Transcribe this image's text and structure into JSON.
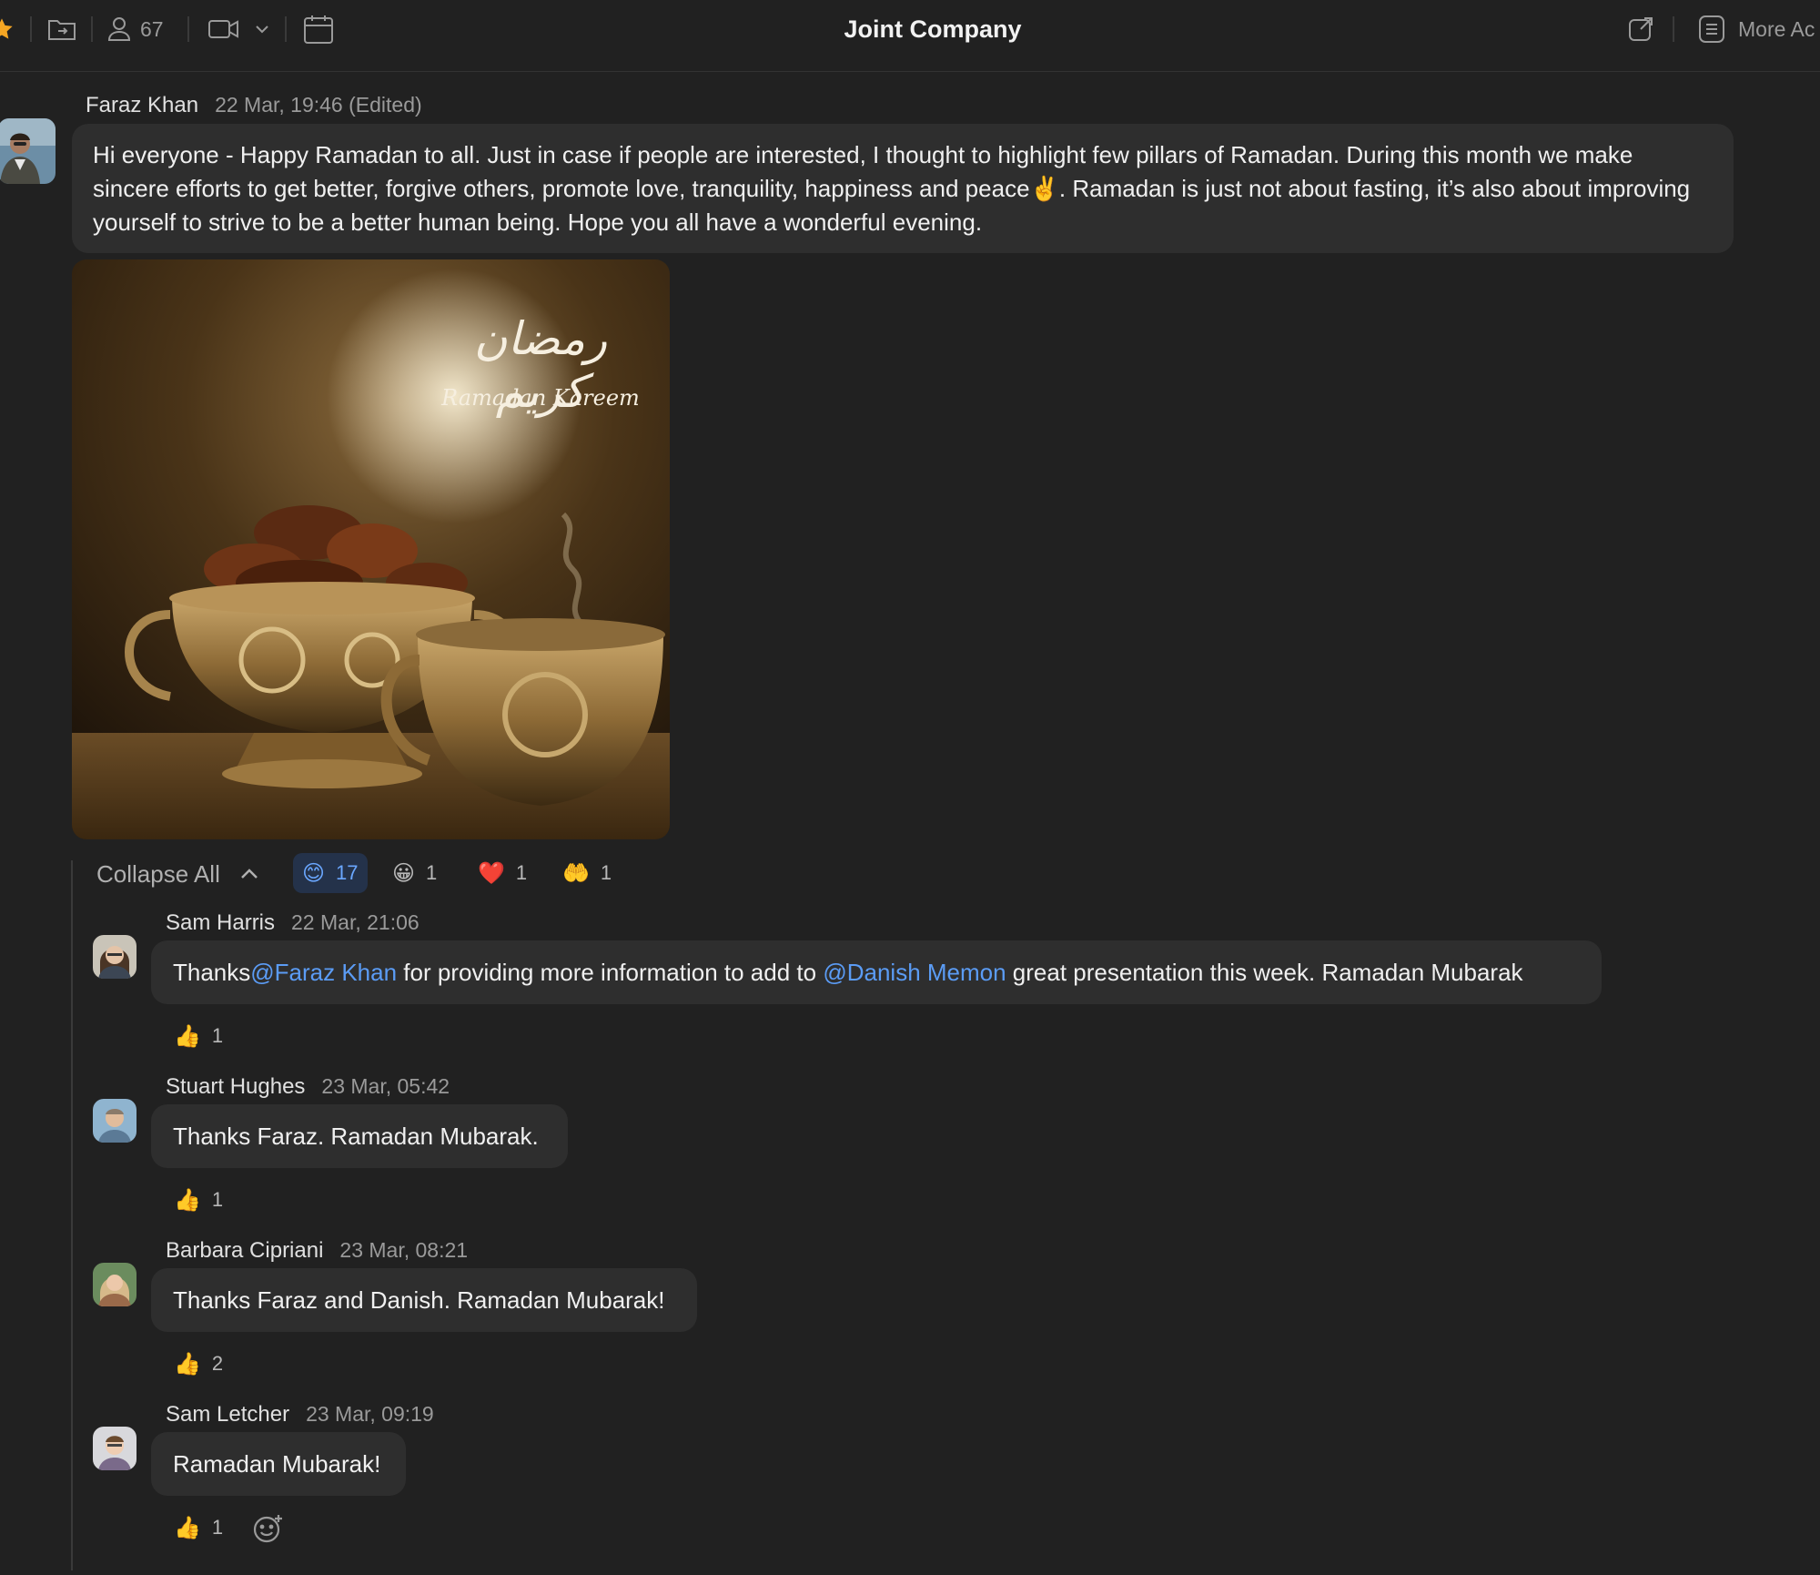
{
  "toolbar": {
    "member_count": "67",
    "channel_title": "Joint Company",
    "more_actions_label": "More Ac"
  },
  "messages": [
    {
      "author": "Faraz Khan",
      "time": "22 Mar, 19:46 (Edited)",
      "text_part1": "Hi everyone - Happy Ramadan to all. Just in case if people are interested, I thought to highlight few pillars of Ramadan. During this month we make sincere efforts to get better, forgive others, promote love, tranquility, happiness and peace",
      "emoji": "✌️",
      "text_part2": ". Ramadan is just not about fasting, it’s also about improving yourself to strive to be a better human being. Hope you all have a wonderful evening.",
      "image": {
        "arabic": "رمضان كريم",
        "caption": "Ramadan Kareem"
      }
    }
  ],
  "thread": {
    "collapse_label": "Collapse All",
    "reactions": [
      {
        "emoji": "😊",
        "count": "17"
      },
      {
        "emoji": "😀",
        "count": "1"
      },
      {
        "emoji": "❤️",
        "count": "1"
      },
      {
        "emoji": "🤲",
        "count": "1"
      }
    ],
    "replies": [
      {
        "author": "Sam Harris",
        "time": "22 Mar, 21:06",
        "text_a": "Thanks ",
        "mention_1": "@Faraz Khan",
        "text_b": " for providing more information to add to ",
        "mention_2": "@Danish Memon",
        "text_c": " great presentation this week. Ramadan Mubarak",
        "reaction_emoji": "👍",
        "reaction_count": "1"
      },
      {
        "author": "Stuart Hughes",
        "time": "23 Mar, 05:42",
        "text": "Thanks Faraz. Ramadan Mubarak.",
        "reaction_emoji": "👍",
        "reaction_count": "1"
      },
      {
        "author": "Barbara Cipriani",
        "time": "23 Mar, 08:21",
        "text": "Thanks Faraz and Danish. Ramadan Mubarak!",
        "reaction_emoji": "👍",
        "reaction_count": "2"
      },
      {
        "author": "Sam Letcher",
        "time": "23 Mar, 09:19",
        "text": "Ramadan Mubarak!",
        "reaction_emoji": "👍",
        "reaction_count": "1"
      }
    ]
  },
  "colors": {
    "background": "#212121",
    "bubble": "#2e2e2e",
    "mention": "#5b9cf5",
    "star": "#f5a623"
  }
}
